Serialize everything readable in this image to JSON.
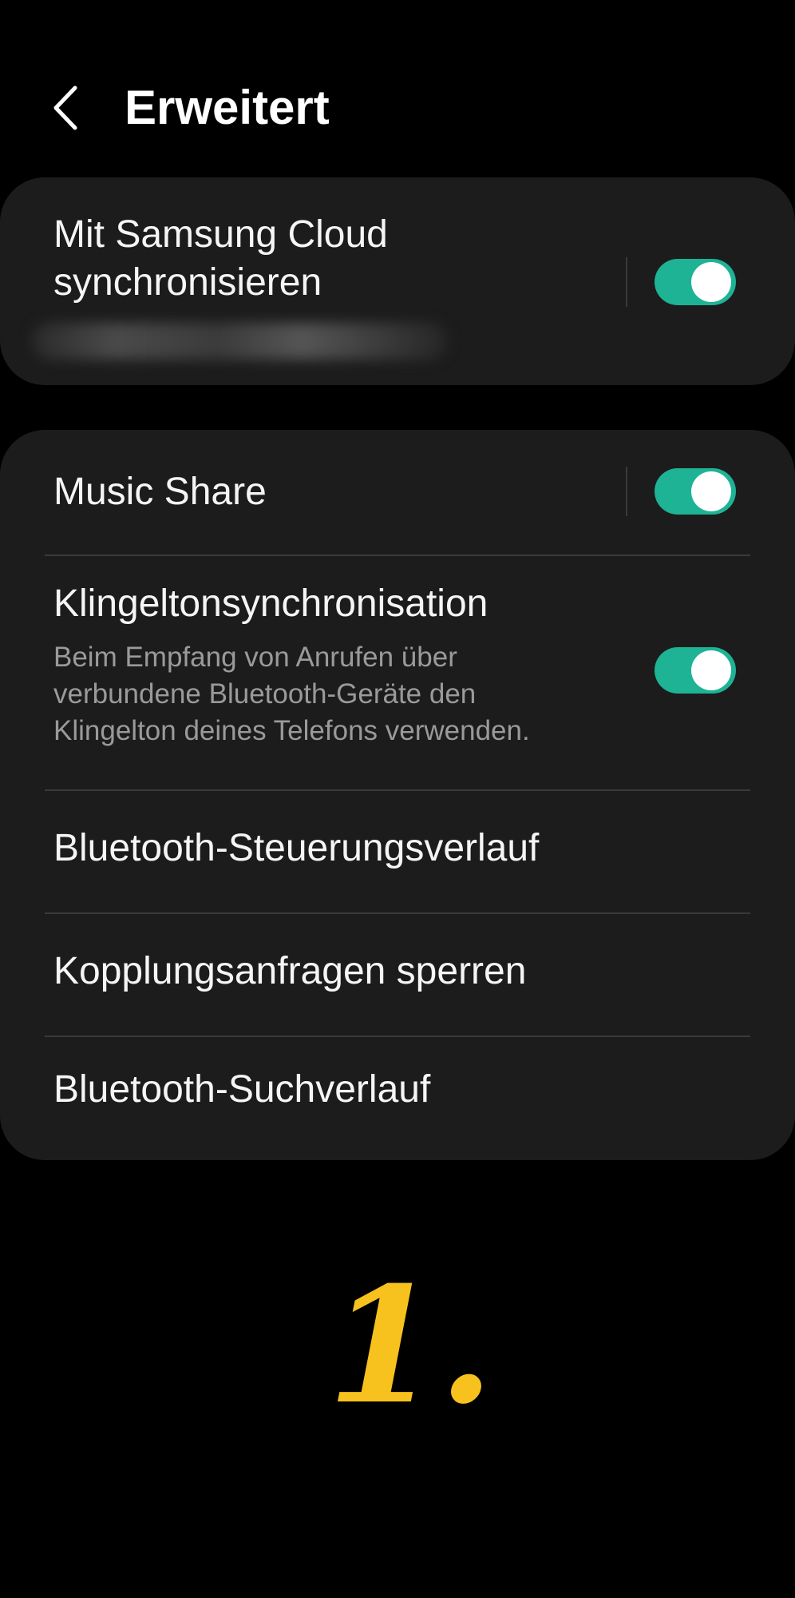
{
  "header": {
    "title": "Erweitert",
    "back_icon": "chevron-left-icon"
  },
  "cloud_card": {
    "sync_title": "Mit Samsung Cloud synchronisieren",
    "sync_toggle_on": true
  },
  "settings_card": {
    "music_share": {
      "title": "Music Share",
      "toggle_on": true
    },
    "ringtone_sync": {
      "title": "Klingeltonsynchronisation",
      "subtitle_line1": "Beim Empfang von Anrufen über",
      "subtitle_line2": "verbundene Bluetooth-Geräte den",
      "subtitle_line3": "Klingelton deines Telefons verwenden.",
      "toggle_on": true
    },
    "control_history": {
      "title": "Bluetooth-Steuerungsverlauf"
    },
    "block_pairing": {
      "title": "Kopplungsanfragen sperren"
    },
    "scan_history": {
      "title": "Bluetooth-Suchverlauf"
    }
  },
  "overlay": {
    "step_number": "1."
  },
  "colors": {
    "background": "#000000",
    "card": "#1c1c1c",
    "accent_toggle": "#1db394",
    "overlay_text": "#f7c21e"
  }
}
